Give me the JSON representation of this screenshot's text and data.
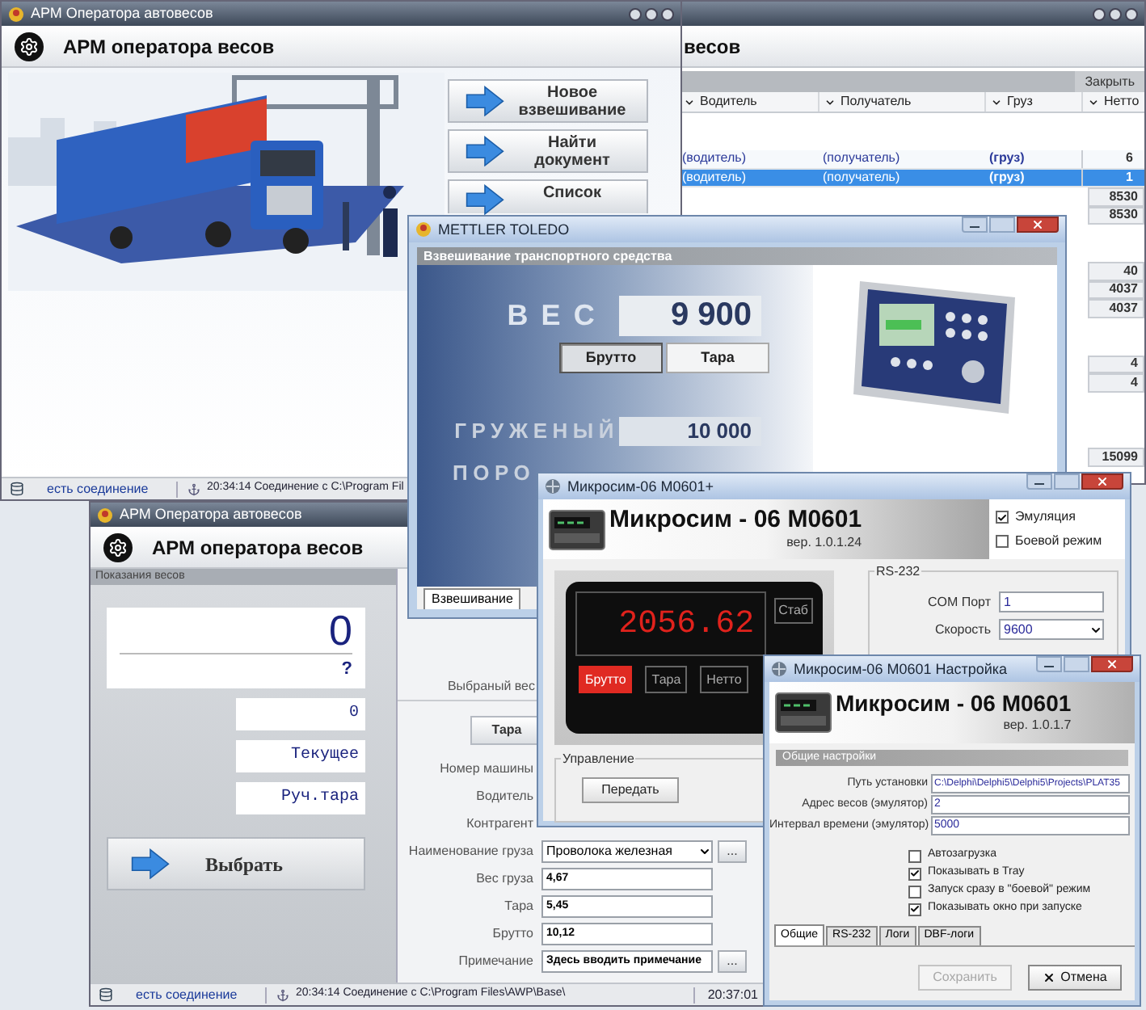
{
  "journal_window": {
    "header": "весов",
    "close_button": "Закрыть",
    "columns": [
      "Водитель",
      "Получатель",
      "Груз",
      "Нетто"
    ],
    "rows": [
      {
        "driver": "(водитель)",
        "recipient": "(получатель)",
        "cargo": "(груз)",
        "netto": "6",
        "selected": false
      },
      {
        "driver": "(водитель)",
        "recipient": "(получатель)",
        "cargo": "(груз)",
        "netto": "1",
        "selected": true
      },
      {
        "netto": "8530",
        "selected": false
      },
      {
        "netto": "8530",
        "selected": false
      },
      {
        "netto": "40",
        "selected": false
      },
      {
        "netto": "4037",
        "selected": false
      },
      {
        "netto": "4037",
        "selected": false
      },
      {
        "netto": "4",
        "selected": false
      },
      {
        "netto": "4",
        "selected": false
      },
      {
        "netto": "15099",
        "selected": false
      }
    ]
  },
  "main_window": {
    "title": "АРМ Оператора автовесов",
    "header": "АРМ оператора весов",
    "actions": [
      "Новое взвешивание",
      "Найти документ",
      "Список"
    ],
    "status": {
      "connection": "есть соединение",
      "message": "20:34:14 Соединение с C:\\Program Fil"
    }
  },
  "operator_window": {
    "title": "АРМ Оператора автовесов",
    "header": "АРМ оператора весов",
    "scale_panel": {
      "title": "Показания весов",
      "weight": "0",
      "stability": "?",
      "tare": "0",
      "mode": "Текущее",
      "tare_mode": "Руч.тара",
      "select_button": "Выбрать"
    },
    "selected_weight_label": "Выбраный вес",
    "tare_button": "Тара",
    "fields": [
      {
        "label": "Номер машины",
        "kind": "label"
      },
      {
        "label": "Водитель",
        "kind": "label"
      },
      {
        "label": "Контрагент",
        "kind": "label"
      },
      {
        "label": "Наименование груза",
        "kind": "dropdown",
        "value": "Проволока железная",
        "button": "..."
      },
      {
        "label": "Вес груза",
        "kind": "text",
        "value": "4,67"
      },
      {
        "label": "Тара",
        "kind": "text",
        "value": "5,45"
      },
      {
        "label": "Брутто",
        "kind": "text",
        "value": "10,12"
      },
      {
        "label": "Примечание",
        "kind": "text",
        "value": "Здесь вводить примечание",
        "button": "..."
      }
    ],
    "status": {
      "connection": "есть соединение",
      "message": "20:34:14 Соединение с C:\\Program Files\\AWP\\Base\\",
      "time": "20:37:01"
    }
  },
  "mettler_window": {
    "title": "METTLER TOLEDO",
    "section": "Взвешивание транспортного средства",
    "weight_label": "ВЕС",
    "weight": "9 900",
    "modes": [
      {
        "label": "Брутто",
        "selected": true
      },
      {
        "label": "Тара",
        "selected": false
      }
    ],
    "loaded_label": "ГРУЖЕНЫЙ",
    "loaded": "10 000",
    "empty_label": "ПОРО",
    "tabs": [
      {
        "label": "Взвешивание",
        "selected": true
      }
    ]
  },
  "microsim_window": {
    "title": "Микросим-06 M0601+",
    "product": "Микросим - 06 M0601",
    "version": "вер. 1.0.1.24",
    "options": [
      {
        "label": "Эмуляция",
        "checked": true
      },
      {
        "label": "Боевой режим",
        "checked": false
      }
    ],
    "display": "2056.62",
    "stable_label": "Стаб",
    "modes": [
      {
        "label": "Брутто",
        "selected": true
      },
      {
        "label": "Тара",
        "selected": false
      },
      {
        "label": "Нетто",
        "selected": false
      }
    ],
    "control_group": "Управление",
    "send_button": "Передать",
    "rs232": {
      "title": "RS-232",
      "fields": [
        {
          "label": "COM Порт",
          "value": "1",
          "kind": "text"
        },
        {
          "label": "Скорость",
          "value": "9600",
          "kind": "dropdown"
        }
      ]
    }
  },
  "settings_window": {
    "title": "Микросим-06 M0601 Настройка",
    "product": "Микросим - 06 M0601",
    "version": "вер. 1.0.1.7",
    "section": "Общие настройки",
    "fields": [
      {
        "label": "Путь установки",
        "value": "C:\\Delphi\\Delphi5\\Delphi5\\Projects\\PLAT35"
      },
      {
        "label": "Адрес весов (эмулятор)",
        "value": "2"
      },
      {
        "label": "Интервал времени (эмулятор)",
        "value": "5000"
      }
    ],
    "options": [
      {
        "label": "Автозагрузка",
        "checked": false
      },
      {
        "label": "Показывать в Tray",
        "checked": true
      },
      {
        "label": "Запуск сразу в \"боевой\" режим",
        "checked": false
      },
      {
        "label": "Показывать окно при запуске",
        "checked": true
      }
    ],
    "tabs": [
      {
        "label": "Общие",
        "selected": true
      },
      {
        "label": "RS-232",
        "selected": false
      },
      {
        "label": "Логи",
        "selected": false
      },
      {
        "label": "DBF-логи",
        "selected": false
      }
    ],
    "buttons": [
      {
        "label": "Сохранить",
        "disabled": true,
        "kind": "save"
      },
      {
        "label": "Отмена",
        "disabled": false,
        "kind": "cancel"
      }
    ]
  }
}
